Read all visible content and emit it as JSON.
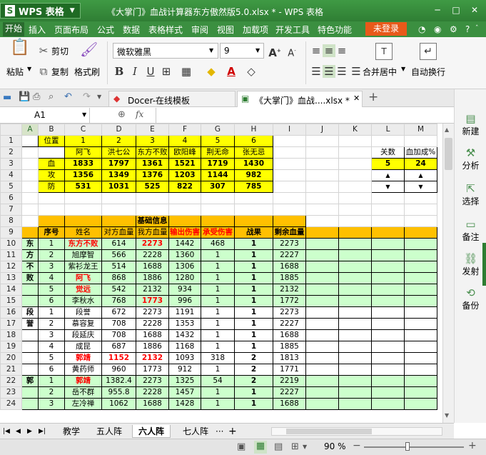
{
  "app": {
    "name": "WPS 表格",
    "logo_letter": "S"
  },
  "window": {
    "title": "《大掌门》血战计算器东方傲然版5.0.xlsx * - WPS 表格"
  },
  "menu": {
    "items": [
      "开始",
      "插入",
      "页面布局",
      "公式",
      "数据",
      "表格样式",
      "审阅",
      "视图",
      "加载项",
      "开发工具",
      "特色功能"
    ],
    "login": "未登录"
  },
  "ribbon": {
    "paste": "粘贴",
    "cut": "剪切",
    "copy": "复制",
    "format_painter": "格式刷",
    "font_name": "微软雅黑",
    "font_size": "9",
    "merge_center": "合并居中",
    "auto_wrap": "自动换行"
  },
  "doc_tabs": [
    {
      "label": "Docer-在线模板"
    },
    {
      "label": "《大掌门》血战....xlsx *"
    }
  ],
  "formula_bar": {
    "cell_ref": "A1",
    "fx": "fx",
    "value": ""
  },
  "right_panel": [
    "新建",
    "分析",
    "选择",
    "备注",
    "发射",
    "备份"
  ],
  "columns": [
    "A",
    "B",
    "C",
    "D",
    "E",
    "F",
    "G",
    "H",
    "I",
    "J",
    "K",
    "L",
    "M"
  ],
  "rows": [
    "1",
    "2",
    "3",
    "4",
    "5",
    "6",
    "7",
    "8",
    "9",
    "10",
    "11",
    "12",
    "13",
    "14",
    "15",
    "16",
    "17",
    "18",
    "19",
    "20",
    "21",
    "22",
    "23",
    "24"
  ],
  "top_table": {
    "pos_label": "位置",
    "positions": [
      "1",
      "2",
      "3",
      "4",
      "5",
      "6"
    ],
    "names": [
      "阿飞",
      "洪七公",
      "东方不败",
      "欧阳峰",
      "荆无命",
      "张无忌"
    ],
    "rows": [
      {
        "label": "血",
        "values": [
          "1833",
          "1797",
          "1361",
          "1521",
          "1719",
          "1430"
        ]
      },
      {
        "label": "攻",
        "values": [
          "1356",
          "1349",
          "1376",
          "1203",
          "1144",
          "982"
        ]
      },
      {
        "label": "防",
        "values": [
          "531",
          "1031",
          "525",
          "822",
          "307",
          "785"
        ]
      }
    ]
  },
  "side_box": {
    "labels": [
      "关数",
      "血加成%"
    ],
    "values": [
      "5",
      "24"
    ]
  },
  "main_table": {
    "title": "基础信息",
    "headers": [
      "序号",
      "姓名",
      "对方血量",
      "我方血量",
      "输出伤害",
      "承受伤害",
      "战果",
      "剩余血量"
    ],
    "groups": [
      {
        "name": "东方不败",
        "rows": [
          [
            "1",
            "东方不败",
            "614",
            "2273",
            "1442",
            "468",
            "1",
            "2273"
          ],
          [
            "2",
            "旭摩智",
            "566",
            "2228",
            "1360",
            "1",
            "1",
            "2227"
          ],
          [
            "3",
            "紫衫龙王",
            "514",
            "1688",
            "1306",
            "1",
            "1",
            "1688"
          ],
          [
            "4",
            "阿飞",
            "868",
            "1886",
            "1280",
            "1",
            "1",
            "1885"
          ],
          [
            "5",
            "觉远",
            "542",
            "2132",
            "934",
            "1",
            "1",
            "2132"
          ],
          [
            "6",
            "李秋水",
            "768",
            "1773",
            "996",
            "1",
            "1",
            "1772"
          ]
        ]
      },
      {
        "name": "段誉",
        "rows": [
          [
            "1",
            "段誉",
            "672",
            "2273",
            "1191",
            "1",
            "1",
            "2273"
          ],
          [
            "2",
            "慕容复",
            "708",
            "2228",
            "1353",
            "1",
            "1",
            "2227"
          ],
          [
            "3",
            "段延庆",
            "708",
            "1688",
            "1432",
            "1",
            "1",
            "1688"
          ],
          [
            "4",
            "成昆",
            "687",
            "1886",
            "1168",
            "1",
            "1",
            "1885"
          ],
          [
            "5",
            "郭靖",
            "1152",
            "2132",
            "1093",
            "318",
            "2",
            "1813"
          ],
          [
            "6",
            "黄药师",
            "960",
            "1773",
            "912",
            "1",
            "2",
            "1771"
          ]
        ]
      },
      {
        "name": "郭",
        "rows": [
          [
            "1",
            "郭靖",
            "1382.4",
            "2273",
            "1325",
            "54",
            "2",
            "2219"
          ],
          [
            "2",
            "岳不群",
            "955.8",
            "2228",
            "1457",
            "1",
            "1",
            "2227"
          ],
          [
            "3",
            "左冷禅",
            "1062",
            "1688",
            "1428",
            "1",
            "1",
            "1688"
          ]
        ]
      }
    ]
  },
  "sheet_tabs": [
    "教学",
    "五人阵",
    "六人阵",
    "七人阵"
  ],
  "active_sheet": "六人阵",
  "status": {
    "zoom": "90 %"
  }
}
